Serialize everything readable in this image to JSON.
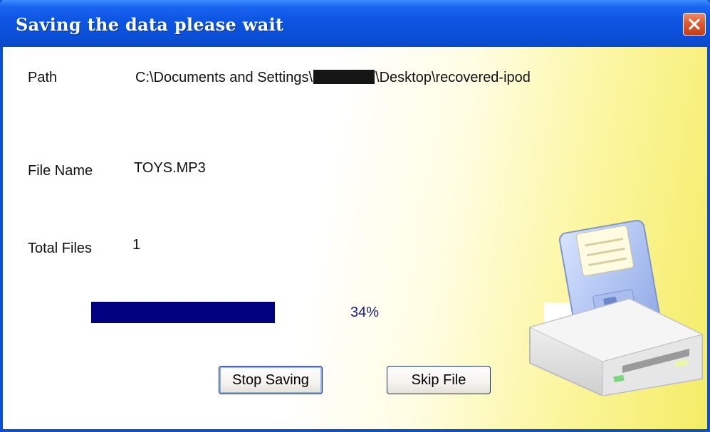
{
  "window": {
    "title": "Saving the data please wait"
  },
  "fields": {
    "path_label": "Path",
    "path_prefix": "C:\\Documents and Settings\\",
    "path_suffix": "\\Desktop\\recovered-ipod",
    "file_name_label": "File Name",
    "file_name_value": "TOYS.MP3",
    "total_files_label": "Total Files",
    "total_files_value": "1"
  },
  "progress": {
    "percent_text": "34%",
    "fraction": 0.34
  },
  "buttons": {
    "stop_label": "Stop Saving",
    "skip_label": "Skip File"
  },
  "icons": {
    "close": "close-icon",
    "disk": "floppy-drive-icon"
  },
  "colors": {
    "title_bar": "#0b4fd9",
    "progress_fill": "#000080",
    "close_button": "#de5a32"
  }
}
